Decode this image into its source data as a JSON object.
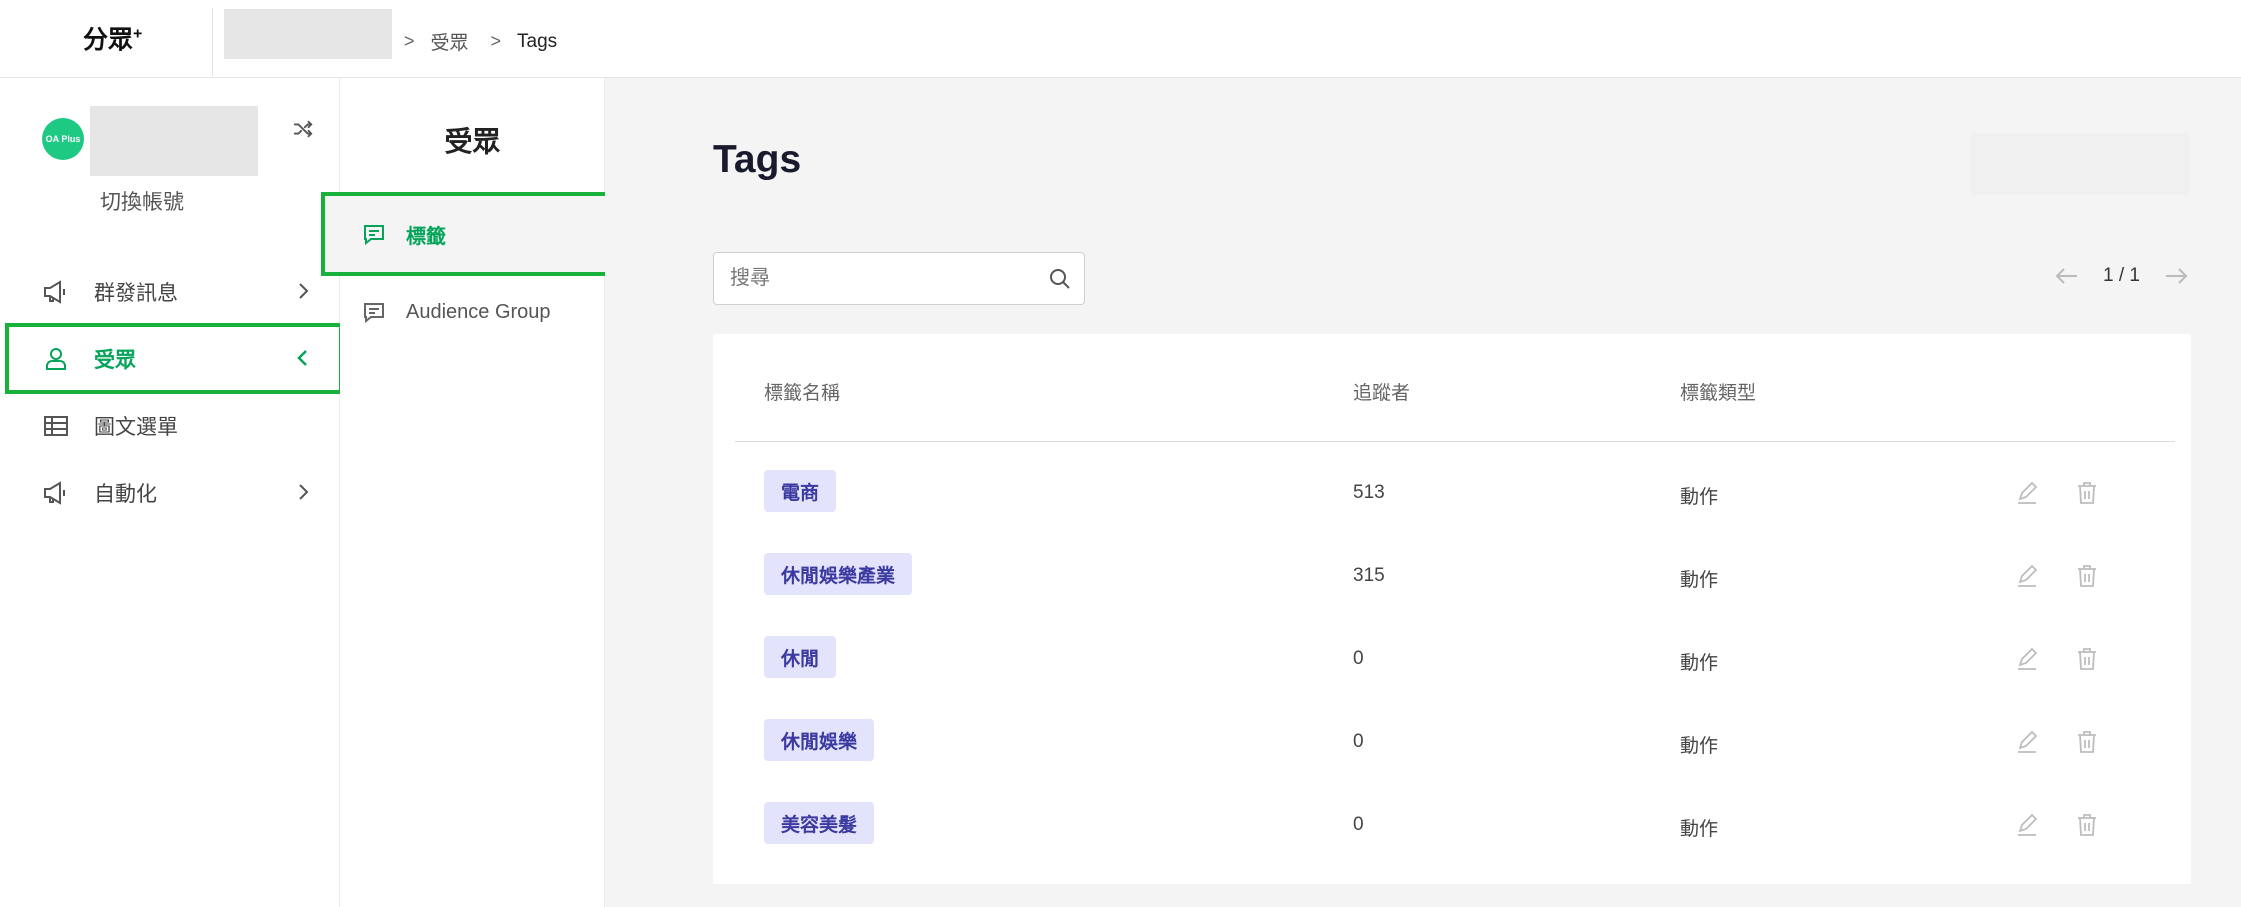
{
  "brand": {
    "logo": "分眾",
    "logo_sup": "+"
  },
  "breadcrumb": {
    "items": [
      "受眾",
      "Tags"
    ],
    "separator": ">"
  },
  "account": {
    "avatar_text": "OA Plus",
    "switch_label": "切換帳號"
  },
  "sidebar": {
    "items": [
      {
        "label": "群發訊息",
        "icon": "megaphone-icon",
        "chevron": "right"
      },
      {
        "label": "受眾",
        "icon": "user-icon",
        "chevron": "left",
        "active": true
      },
      {
        "label": "圖文選單",
        "icon": "table-icon"
      },
      {
        "label": "自動化",
        "icon": "megaphone-icon",
        "chevron": "right"
      }
    ]
  },
  "subsidebar": {
    "title": "受眾",
    "items": [
      {
        "label": "標籤",
        "icon": "message-icon",
        "active": true
      },
      {
        "label": "Audience Group",
        "icon": "message-icon"
      }
    ]
  },
  "main": {
    "title": "Tags",
    "search": {
      "placeholder": "搜尋",
      "value": ""
    },
    "pager": {
      "text": "1 / 1"
    },
    "table": {
      "columns": [
        "標籤名稱",
        "追蹤者",
        "標籤類型"
      ],
      "rows": [
        {
          "name": "電商",
          "followers": "513",
          "type": "動作"
        },
        {
          "name": "休閒娛樂產業",
          "followers": "315",
          "type": "動作"
        },
        {
          "name": "休閒",
          "followers": "0",
          "type": "動作"
        },
        {
          "name": "休閒娛樂",
          "followers": "0",
          "type": "動作"
        },
        {
          "name": "美容美髮",
          "followers": "0",
          "type": "動作"
        }
      ]
    }
  },
  "colors": {
    "accent": "#06a45b",
    "highlight": "#17b13b",
    "tag_bg": "#e3e3fb",
    "tag_text": "#3b3aa0"
  }
}
